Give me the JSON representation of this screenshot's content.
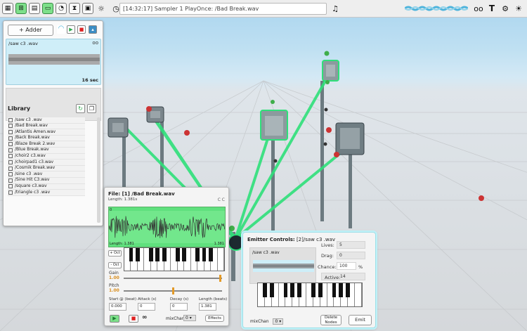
{
  "topbar": {
    "status": "[14:32:17] Sampler 1 PlayOnce: /Bad Break.wav",
    "left_icons": [
      "grid-icon",
      "add-window-icon",
      "panel-icon",
      "monitor-icon",
      "stopwatch-icon",
      "timer-icon",
      "save-icon",
      "brightness-icon"
    ],
    "info_icon": "clock-info-icon",
    "right_icons": [
      "record-icon",
      "text-icon",
      "settings-icon",
      "theme-icon"
    ]
  },
  "left_panel": {
    "adder_label": "+ Adder",
    "selected_sample": {
      "name": "/saw c3 .wav",
      "loop_glyph": "oo",
      "duration": "16 sec"
    },
    "library_title": "Library",
    "library_items": [
      "/saw c3 .wav",
      "/Bad Break.wav",
      "/Atlantis Amen.wav",
      "/Back Break.wav",
      "/Blaze Break 2.wav",
      "/Blue Break.wav",
      "/choir2 c3.wav",
      "/choirpad1 c3.wav",
      "/Cosmik Break.wav",
      "/sine c3 .wav",
      "/Sine Hit C3.wav",
      "/square c3.wav",
      "/triangle c3 .wav"
    ]
  },
  "file_panel": {
    "title": "File: [1] /Bad Break.wav",
    "length": "Length: 1.381s",
    "cc": "C C",
    "wave_start": "0",
    "wave_length_label": "Length: 1.381",
    "wave_end": "1.381",
    "oct_up": "+ Oct",
    "oct_down": "- Oct",
    "gain_label": "Gain",
    "gain_value": "1.00",
    "gain_fraction": 0.98,
    "pitch_label": "Pitch",
    "pitch_value": "1.00",
    "pitch_fraction": 0.5,
    "params": {
      "start_label": "Start @ (beat)",
      "start_value": "0.000",
      "attack_label": "Attack (s)",
      "attack_value": "0",
      "decay_label": "Decay (s)",
      "decay_value": "0",
      "length_label": "Length (beats)",
      "length_value": "1.381"
    },
    "loop_glyph": "∞",
    "mixchan_label": "mixChan",
    "mixchan_value": "0",
    "effects_label": "Effects"
  },
  "emitter_panel": {
    "title_bold": "Emitter Controls:",
    "title_rest": "[2]/saw c3 .wav",
    "sample_name": "/saw c3 .wav",
    "lives_label": "Lives:",
    "lives_value": "5",
    "drag_label": "Drag:",
    "drag_value": "0",
    "chance_label": "Chance:",
    "chance_value": "100",
    "chance_unit": "%",
    "active_label": "Active:",
    "active_value": "14",
    "mixchan_label": "mixChan",
    "mixchan_value": "0",
    "delete_label": "Delete Nodes",
    "emit_label": "Emit"
  },
  "colors": {
    "accent_green": "#5fe07d",
    "laser_green": "#2fe07a",
    "panel_cyan": "#cfeef8",
    "slider_orange": "#e39a28"
  }
}
